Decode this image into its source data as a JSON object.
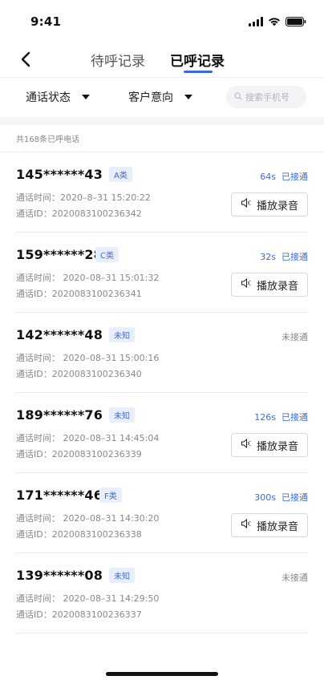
{
  "status_bar": {
    "time": "9:41"
  },
  "nav": {
    "tabs": [
      {
        "label": "待呼记录",
        "active": false
      },
      {
        "label": "已呼记录",
        "active": true
      }
    ]
  },
  "filters": {
    "call_status": "通话状态",
    "customer_intent": "客户意向",
    "search_placeholder": "搜索手机号"
  },
  "summary": "共168条已呼电话",
  "play_label": "播放录音",
  "records": [
    {
      "phone": "145******43",
      "tag": "A类",
      "duration": "64s",
      "status": "已接通",
      "answered": true,
      "time": "通话时间：2020–8–31 15:20:22",
      "id": "通话ID：2020083100236342"
    },
    {
      "phone": "159******28",
      "tag": "C类",
      "duration": "32s",
      "status": "已接通",
      "answered": true,
      "time": "通话时间： 2020–08–31 15:01:32",
      "id": "通话ID：2020083100236341"
    },
    {
      "phone": "142******48",
      "tag": "未知",
      "duration": "",
      "status": "未接通",
      "answered": false,
      "time": "通话时间： 2020–08–31 15:00:16",
      "id": "通话ID：2020083100236340"
    },
    {
      "phone": "189******76",
      "tag": "未知",
      "duration": "126s",
      "status": "已接通",
      "answered": true,
      "time": "通话时间： 2020–08–31 14:45:04",
      "id": "通话ID：2020083100236339"
    },
    {
      "phone": "171******46",
      "tag": "F类",
      "duration": "300s",
      "status": "已接通",
      "answered": true,
      "time": "通话时间： 2020–08–31 14:30:20",
      "id": "通话ID：2020083100236338"
    },
    {
      "phone": "139******08",
      "tag": "未知",
      "duration": "",
      "status": "未接通",
      "answered": false,
      "time": "通话时间： 2020–08–31 14:29:50",
      "id": "通话ID：2020083100236337"
    }
  ],
  "colors": {
    "accent": "#3b6ae6",
    "tag_bg": "#e8eefc",
    "muted": "#888888"
  },
  "icons": [
    "back-arrow-icon",
    "search-icon",
    "speaker-icon",
    "signal-icon",
    "wifi-icon",
    "battery-icon",
    "caret-down-icon"
  ]
}
